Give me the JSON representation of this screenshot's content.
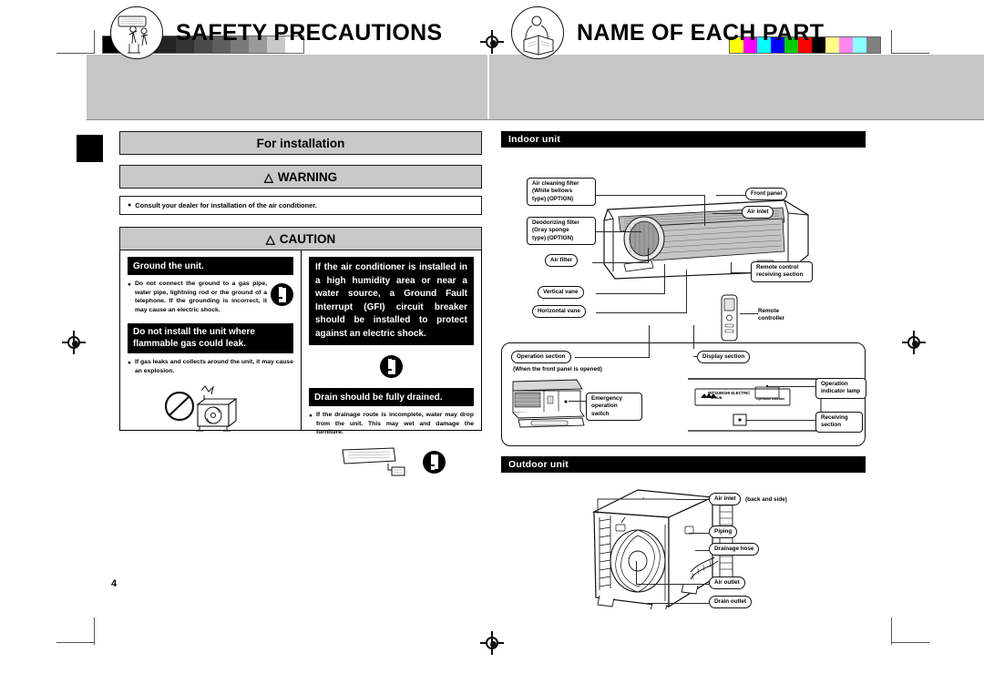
{
  "page": {
    "number": "4"
  },
  "sections": {
    "safety": {
      "title": "SAFETY PRECAUTIONS",
      "icon": "installer-illustration-icon",
      "subhead": "For installation",
      "warning": {
        "label": "WARNING",
        "icon": "warning-triangle-icon"
      },
      "warning_note": "Consult your dealer for installation of the air conditioner.",
      "caution": {
        "label": "CAUTION",
        "icon": "warning-triangle-icon"
      },
      "items": [
        {
          "heading": "Ground the unit.",
          "body": "Do not connect the ground to a gas pipe, water pipe, lightning rod or the ground of a telephone. If the grounding is incorrect, it may cause an electric shock.",
          "icon": "exclamation-mandatory-icon"
        },
        {
          "heading": "Do not install the unit where flammable gas could leak.",
          "body": "If gas leaks and collects around the unit, it may cause an explosion.",
          "icon": "prohibition-outdoor-unit-icon"
        },
        {
          "paragraph": "If the air conditioner is installed in a high humidity area or near a water source, a Ground Fault Interrupt (GFI) circuit breaker should be installed to protect against an electric shock.",
          "icon": "exclamation-mandatory-icon"
        },
        {
          "heading": "Drain should be fully drained.",
          "body": "If the drainage route is incomplete, water may drop from the unit. This may wet and damage the furniture.",
          "icon": "exclamation-mandatory-icon"
        }
      ]
    },
    "parts": {
      "title": "NAME OF EACH PART",
      "icon": "reading-manual-illustration-icon",
      "indoor": {
        "bar_label": "Indoor unit",
        "labels": [
          "Air cleaning filter\n(White bellows\ntype) (OPTION)",
          "Deodorizing filter\n(Gray sponge\ntype) (OPTION)",
          "Air filter",
          "Vertical vane",
          "Horizontal vane",
          "Front panel",
          "Air inlet",
          "Remote control\nreceiving section"
        ],
        "remote_label": "Remote\ncontroller",
        "panel": {
          "operation_section": "Operation section",
          "operation_note": "(When the front panel is opened)",
          "display_section": "Display section",
          "emergency_switch": "Emergency\noperation switch",
          "operation_indicator": "Operation\nindicator lamp",
          "receiving_section": "Receiving\nsection",
          "brand": "MITSUBISHI ELECTRIC",
          "model": "M-SUB",
          "indicator_caption": "Operation indicator"
        }
      },
      "outdoor": {
        "bar_label": "Outdoor unit",
        "labels": [
          "Air inlet",
          "Piping",
          "Drainage hose",
          "Air outlet",
          "Drain outlet"
        ],
        "air_inlet_note": "(back and side)"
      }
    }
  },
  "print_marks": {
    "gray_bar": [
      "#000000",
      "#0a0a0a",
      "#161616",
      "#242424",
      "#343434",
      "#4a4a4a",
      "#5e5e5e",
      "#7a7a7a",
      "#9a9a9a",
      "#c8c8c8",
      "#ffffff"
    ],
    "color_bar": [
      "#ffff00",
      "#ff00ff",
      "#00ffff",
      "#0000ff",
      "#00cc00",
      "#ff0000",
      "#000000",
      "#ffff88",
      "#ff88ee",
      "#88ffff",
      "#808080"
    ]
  }
}
